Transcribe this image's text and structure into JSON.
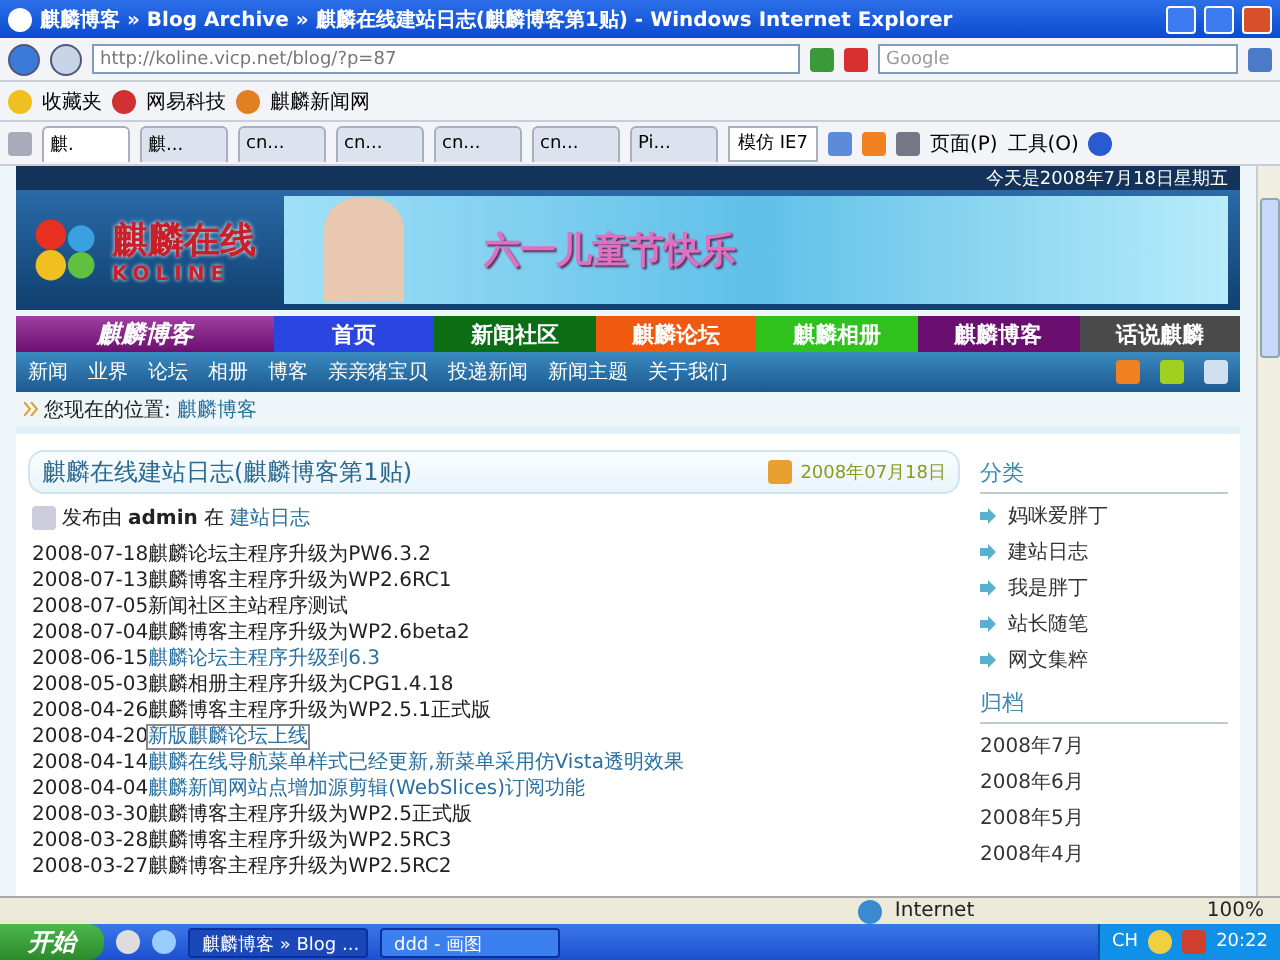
{
  "window": {
    "title": "麒麟博客 » Blog Archive » 麒麟在线建站日志(麒麟博客第1贴) - Windows Internet Explorer"
  },
  "address_bar": {
    "url": "http://koline.vicp.net/blog/?p=87",
    "search_placeholder": "Google"
  },
  "favorites_bar": {
    "items": [
      "收藏夹",
      "网易科技",
      "麒麟新闻网"
    ]
  },
  "tabs": [
    {
      "label": "麒.",
      "selected": true
    },
    {
      "label": "麒...",
      "selected": false
    },
    {
      "label": "cn...",
      "selected": false
    },
    {
      "label": "cn...",
      "selected": false
    },
    {
      "label": "cn...",
      "selected": false
    },
    {
      "label": "cn...",
      "selected": false
    },
    {
      "label": "Pi...",
      "selected": false
    }
  ],
  "tab_button": "模仿 IE7",
  "command_bar": {
    "page": "页面(P)",
    "tools": "工具(O)"
  },
  "page": {
    "date_line": "今天是2008年7月18日星期五",
    "logo": {
      "name": "麒麟在线",
      "latin": "KOLINE"
    },
    "banner_text": "六一儿童节快乐",
    "site_title": "麒麟博客",
    "main_nav": [
      {
        "label": "首页",
        "color": "#2a45e0"
      },
      {
        "label": "新闻社区",
        "color": "#0b6e14"
      },
      {
        "label": "麒麟论坛",
        "color": "#f05a10"
      },
      {
        "label": "麒麟相册",
        "color": "#2fc21c"
      },
      {
        "label": "麒麟博客",
        "color": "#6a0f70"
      },
      {
        "label": "话说麒麟",
        "color": "#4a4a4a"
      }
    ],
    "sub_nav": [
      "新闻",
      "业界",
      "论坛",
      "相册",
      "博客",
      "亲亲猪宝贝",
      "投递新闻",
      "新闻主题",
      "关于我们"
    ],
    "breadcrumb": {
      "label": "您现在的位置:",
      "link": "麒麟博客"
    },
    "post": {
      "title": "麒麟在线建站日志(麒麟博客第1贴)",
      "date": "2008年07月18日",
      "meta": {
        "prefix": "发布由",
        "author": "admin",
        "middle": "在",
        "category": "建站日志"
      },
      "entries": [
        {
          "date": "2008-07-18",
          "text": "麒麟论坛主程序升级为PW6.3.2",
          "linked": false,
          "focused": false
        },
        {
          "date": "2008-07-13",
          "text": "麒麟博客主程序升级为WP2.6RC1",
          "linked": false,
          "focused": false
        },
        {
          "date": "2008-07-05",
          "text": "新闻社区主站程序测试",
          "linked": false,
          "focused": false
        },
        {
          "date": "2008-07-04",
          "text": "麒麟博客主程序升级为WP2.6beta2",
          "linked": false,
          "focused": false
        },
        {
          "date": "2008-06-15",
          "text": "麒麟论坛主程序升级到6.3",
          "linked": true,
          "focused": false
        },
        {
          "date": "2008-05-03",
          "text": "麒麟相册主程序升级为CPG1.4.18",
          "linked": false,
          "focused": false
        },
        {
          "date": "2008-04-26",
          "text": "麒麟博客主程序升级为WP2.5.1正式版",
          "linked": false,
          "focused": false
        },
        {
          "date": "2008-04-20",
          "text": "新版麒麟论坛上线",
          "linked": true,
          "focused": true
        },
        {
          "date": "2008-04-14",
          "text": "麒麟在线导航菜单样式已经更新,新菜单采用仿Vista透明效果",
          "linked": true,
          "focused": false
        },
        {
          "date": "2008-04-04",
          "text": "麒麟新闻网站点增加源剪辑(WebSlices)订阅功能",
          "linked": true,
          "focused": false
        },
        {
          "date": "2008-03-30",
          "text": "麒麟博客主程序升级为WP2.5正式版",
          "linked": false,
          "focused": false
        },
        {
          "date": "2008-03-28",
          "text": "麒麟博客主程序升级为WP2.5RC3",
          "linked": false,
          "focused": false
        },
        {
          "date": "2008-03-27",
          "text": "麒麟博客主程序升级为WP2.5RC2",
          "linked": false,
          "focused": false
        }
      ]
    },
    "sidebar": {
      "categories_title": "分类",
      "categories": [
        "妈咪爱胖丁",
        "建站日志",
        "我是胖丁",
        "站长随笔",
        "网文集粹"
      ],
      "archives_title": "归档",
      "archives": [
        "2008年7月",
        "2008年6月",
        "2008年5月",
        "2008年4月"
      ]
    }
  },
  "status_bar": {
    "zone": "Internet",
    "zoom": "100%"
  },
  "taskbar": {
    "start": "开始",
    "windows": [
      {
        "label": "麒麟博客 » Blog ...",
        "selected": false
      },
      {
        "label": "ddd - 画图",
        "selected": true
      }
    ],
    "language": "CH",
    "clock": "20:22"
  }
}
